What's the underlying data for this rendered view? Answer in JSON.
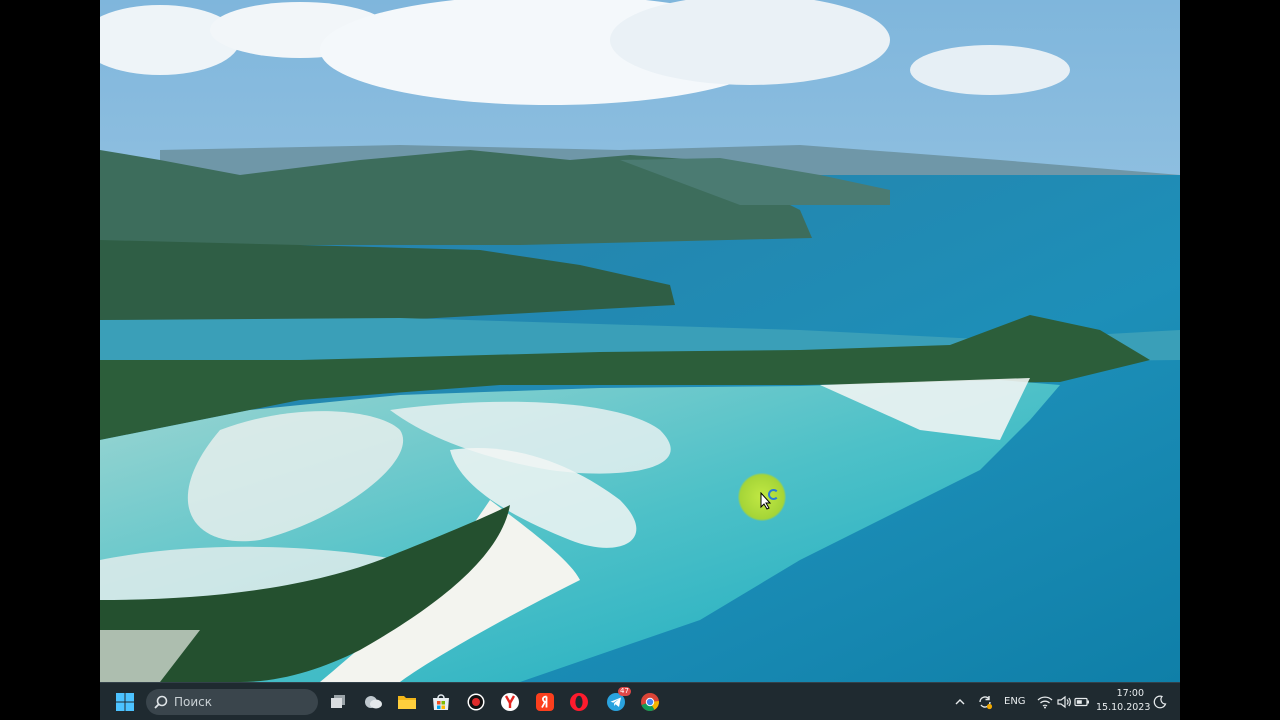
{
  "taskbar": {
    "search_placeholder": "Поиск",
    "telegram_badge": "47",
    "language": "ENG",
    "time": "17:00",
    "date": "15.10.2023"
  },
  "icons": [
    "windows-start-icon",
    "search-icon",
    "task-view-icon",
    "weather-icon",
    "file-explorer-icon",
    "microsoft-store-icon",
    "record-icon",
    "yandex-browser-icon",
    "yandex-icon",
    "opera-icon",
    "telegram-icon",
    "chrome-icon",
    "chevron-up-icon",
    "sync-icon",
    "wifi-icon",
    "volume-icon",
    "battery-icon",
    "moon-icon"
  ],
  "colors": {
    "taskbar_bg": "#1f2a30",
    "cursor_highlight": "#c8eb3c"
  }
}
